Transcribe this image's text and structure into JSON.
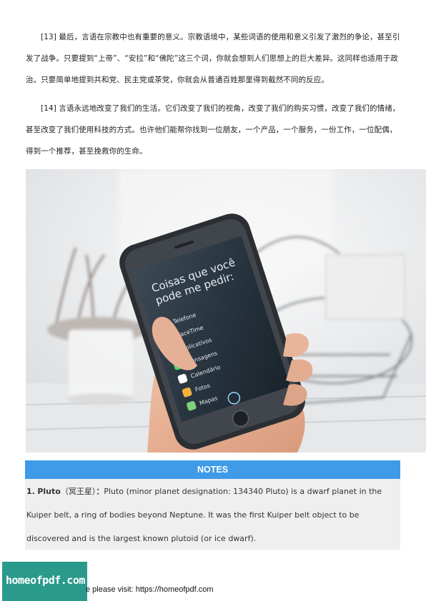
{
  "paragraphs": {
    "p13": {
      "number": "[13]",
      "text": "最后，言语在宗教中也有重要的意义。宗教语境中，某些词语的使用和意义引发了激烈的争论，甚至引发了战争。只要提到“上帝”、“安拉”和“佛陀”这三个词，你就会想到人们思想上的巨大差异。这同样也适用于政治。只要简单地提到共和党、民主党或茶党，你就会从普通百姓那里得到截然不同的反应。"
    },
    "p14": {
      "number": "[14]",
      "text": "言语永远地改变了我们的生活。它们改变了我们的视角，改变了我们的购买习惯，改变了我们的情绪，甚至改变了我们使用科技的方式。也许他们能帮你找到一位朋友，一个产品，一个服务，一份工作，一位配偶，得到一个推荐，甚至挽救你的生命。"
    }
  },
  "photo": {
    "screen_title": "Coisas que você pode me pedir:",
    "apps": [
      "Telefone",
      "FaceTime",
      "Aplicativos",
      "Mensagens",
      "Calendário",
      "Fotos",
      "Mapas"
    ]
  },
  "notes": {
    "header": "NOTES",
    "item_number": "1.",
    "term": "Pluto",
    "term_cn": "（冥王星）",
    "colon": "：",
    "definition": "Pluto (minor planet designation: 134340 Pluto) is a dwarf planet in the Kuiper belt, a ring of bodies beyond Neptune. It was the first Kuiper belt object to be discovered and is the largest known plutoid (or ice dwarf)."
  },
  "footer": {
    "logo_text": "homeofpdf.com",
    "visit_text": "e please visit: https://homeofpdf.com"
  },
  "colors": {
    "notes_header": "#3f9be8",
    "notes_bg": "#efefef",
    "logo_bg": "#2a9a8c"
  }
}
